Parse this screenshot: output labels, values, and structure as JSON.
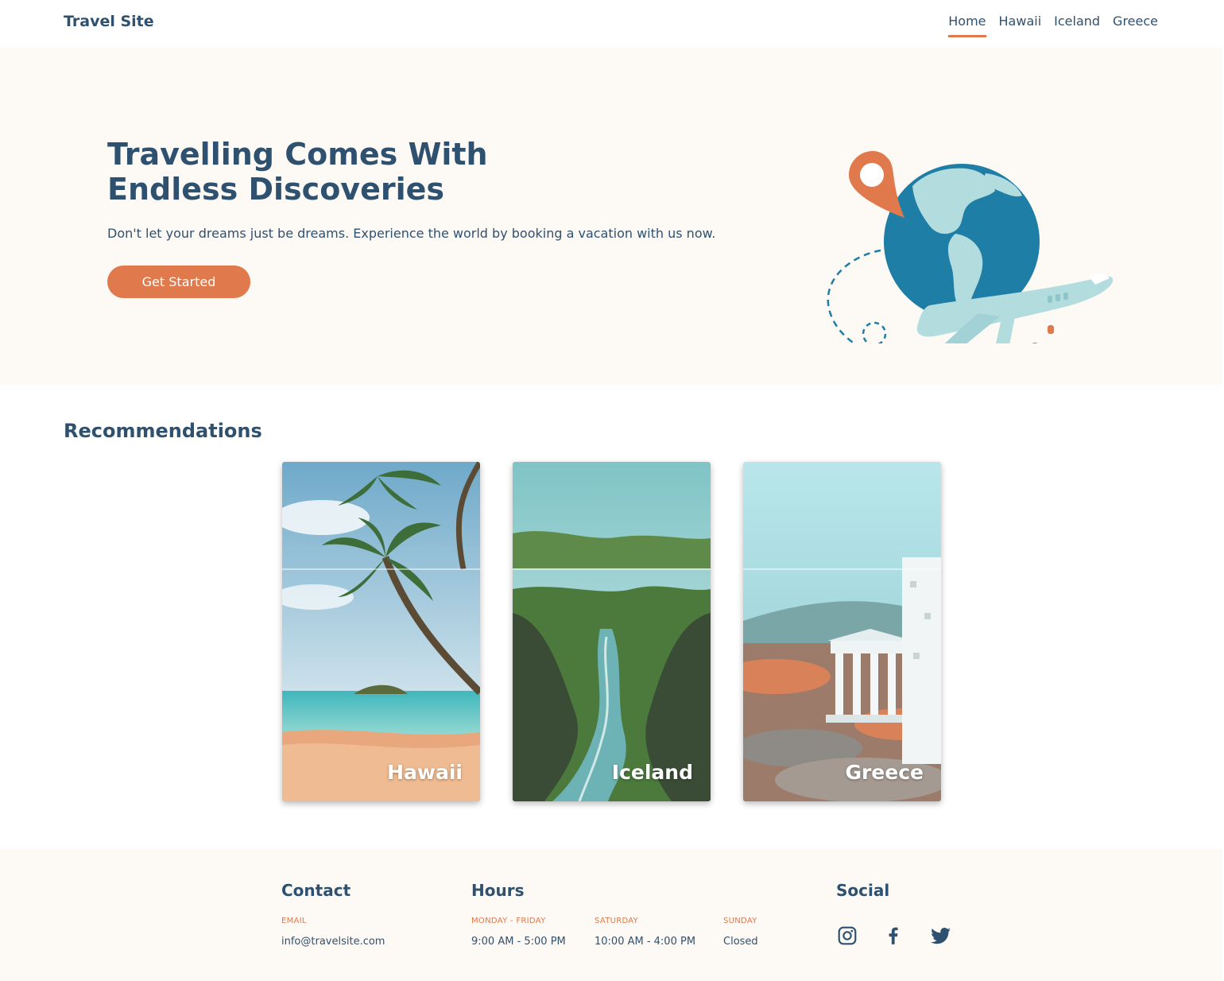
{
  "header": {
    "brand": "Travel Site",
    "nav": [
      "Home",
      "Hawaii",
      "Iceland",
      "Greece"
    ],
    "active_nav": "Home"
  },
  "hero": {
    "title": "Travelling Comes With Endless Discoveries",
    "subtitle": "Don't let your dreams just be dreams. Experience the world by booking a vacation with us now.",
    "cta_label": "Get Started",
    "illustration": "globe-with-map-pin-and-airplane"
  },
  "recommendations": {
    "title": "Recommendations",
    "cards": [
      {
        "label": "Hawaii",
        "image": "palm-tree-beach"
      },
      {
        "label": "Iceland",
        "image": "green-canyon-river"
      },
      {
        "label": "Greece",
        "image": "ancient-temple-ruins"
      }
    ]
  },
  "footer": {
    "contact": {
      "heading": "Contact",
      "email_label": "EMAIL",
      "email": "info@travelsite.com"
    },
    "hours": {
      "heading": "Hours",
      "weekday_label": "MONDAY - FRIDAY",
      "weekday_value": "9:00 AM - 5:00 PM",
      "saturday_label": "SATURDAY",
      "saturday_value": "10:00 AM - 4:00 PM",
      "sunday_label": "SUNDAY",
      "sunday_value": "Closed"
    },
    "social": {
      "heading": "Social",
      "icons": [
        "instagram-icon",
        "facebook-icon",
        "twitter-icon"
      ]
    }
  },
  "colors": {
    "primary_text": "#2f5170",
    "accent": "#e0794b",
    "section_bg": "#fdf9f5",
    "globe_blue": "#1f7ea6",
    "globe_land": "#b3dcdf"
  }
}
